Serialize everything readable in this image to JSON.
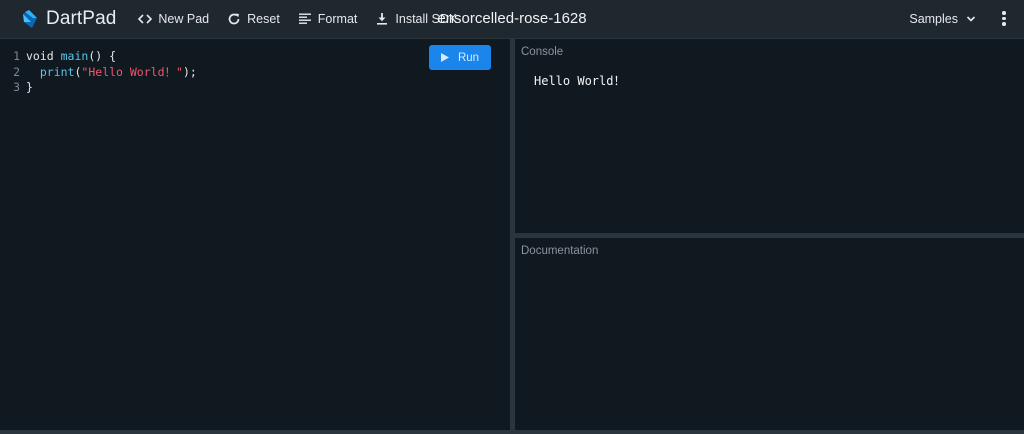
{
  "header": {
    "brand": "DartPad",
    "buttons": [
      {
        "label": "New Pad",
        "icon": "code-icon"
      },
      {
        "label": "Reset",
        "icon": "refresh-icon"
      },
      {
        "label": "Format",
        "icon": "format-align-icon"
      },
      {
        "label": "Install SDK",
        "icon": "download-icon"
      }
    ],
    "title": "ensorcelled-rose-1628",
    "samples_label": "Samples"
  },
  "editor": {
    "run_label": "Run",
    "lines": [
      {
        "num": "1",
        "parts": [
          "void ",
          "main",
          "() {"
        ]
      },
      {
        "num": "2",
        "parts": [
          "  ",
          "print",
          "(",
          "\"Hello World！\"",
          ");"
        ]
      },
      {
        "num": "3",
        "parts": [
          "}"
        ]
      }
    ]
  },
  "console": {
    "title": "Console",
    "output": "Hello World！"
  },
  "documentation": {
    "title": "Documentation"
  },
  "colors": {
    "accent": "#1a85ea",
    "background": "#101820",
    "toolbar": "#1f272f",
    "string": "#f2566b",
    "function": "#5cc4e8"
  }
}
